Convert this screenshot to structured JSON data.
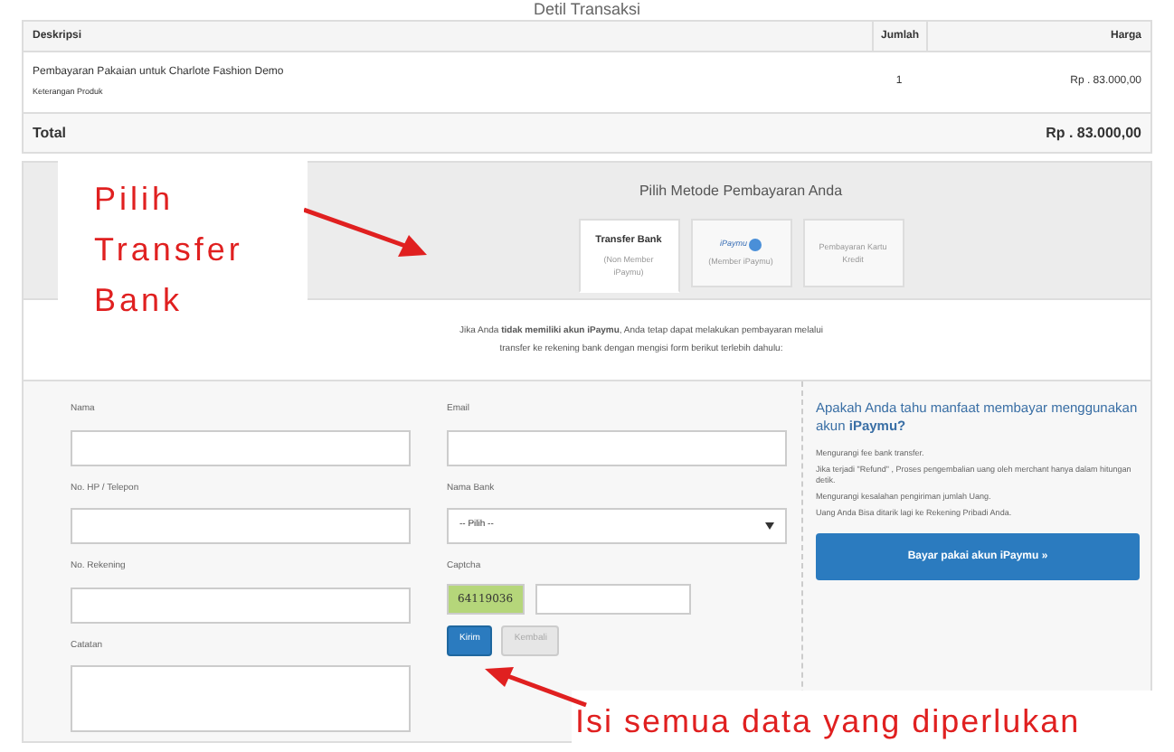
{
  "page_title": "Detil Transaksi",
  "table": {
    "columns": [
      "Deskripsi",
      "Jumlah",
      "Harga"
    ],
    "rows": [
      {
        "description": "Pembayaran Pakaian untuk Charlote Fashion Demo",
        "note": "Keterangan Produk",
        "quantity": "1",
        "price": "Rp . 83.000,00"
      }
    ],
    "total_label": "Total",
    "total_value": "Rp . 83.000,00"
  },
  "payment": {
    "heading": "Pilih Metode Pembayaran Anda",
    "methods": [
      {
        "kind": "text",
        "title": "Transfer Bank",
        "subtitle": "(Non Member iPaymu)",
        "selected": true
      },
      {
        "kind": "logo",
        "title": "iPaymu",
        "subtitle": "(Member iPaymu)",
        "selected": false
      },
      {
        "kind": "plain",
        "subtitle": "Pembayaran Kartu Kredit",
        "selected": false
      }
    ],
    "intro": "Jika Anda **tidak memiliki akun iPaymu**, Anda tetap dapat melakukan pembayaran melalui transfer ke rekening bank dengan mengisi form berikut terlebih dahulu:"
  },
  "form": {
    "left": [
      {
        "kind": "input",
        "label": "Nama"
      },
      {
        "kind": "input",
        "label": "No. HP / Telepon"
      },
      {
        "kind": "input",
        "label": "No. Rekening"
      },
      {
        "kind": "textarea",
        "label": "Catatan"
      }
    ],
    "email_label": "Email",
    "bank_label": "Nama Bank",
    "bank_value": "-- Pilih --",
    "captcha_label": "Captcha",
    "captcha_code": "64119036",
    "buttons": [
      {
        "label": "Kirim",
        "disabled": false
      },
      {
        "label": "Kembali",
        "disabled": true
      }
    ]
  },
  "info": {
    "heading": "Apakah Anda tahu manfaat membayar menggunakan akun **iPaymu?**",
    "points": [
      "Mengurangi fee bank transfer.",
      "Jika terjadi \"Refund\" , Proses pengembalian uang oleh merchant hanya dalam hitungan detik.",
      "Mengurangi kesalahan pengiriman jumlah Uang.",
      "Uang Anda Bisa ditarik lagi ke Rekening Pribadi Anda."
    ],
    "button": "Bayar pakai akun iPaymu »"
  },
  "annotations": [
    "Pilih Transfer Bank",
    "Isi semua data yang diperlukan"
  ]
}
